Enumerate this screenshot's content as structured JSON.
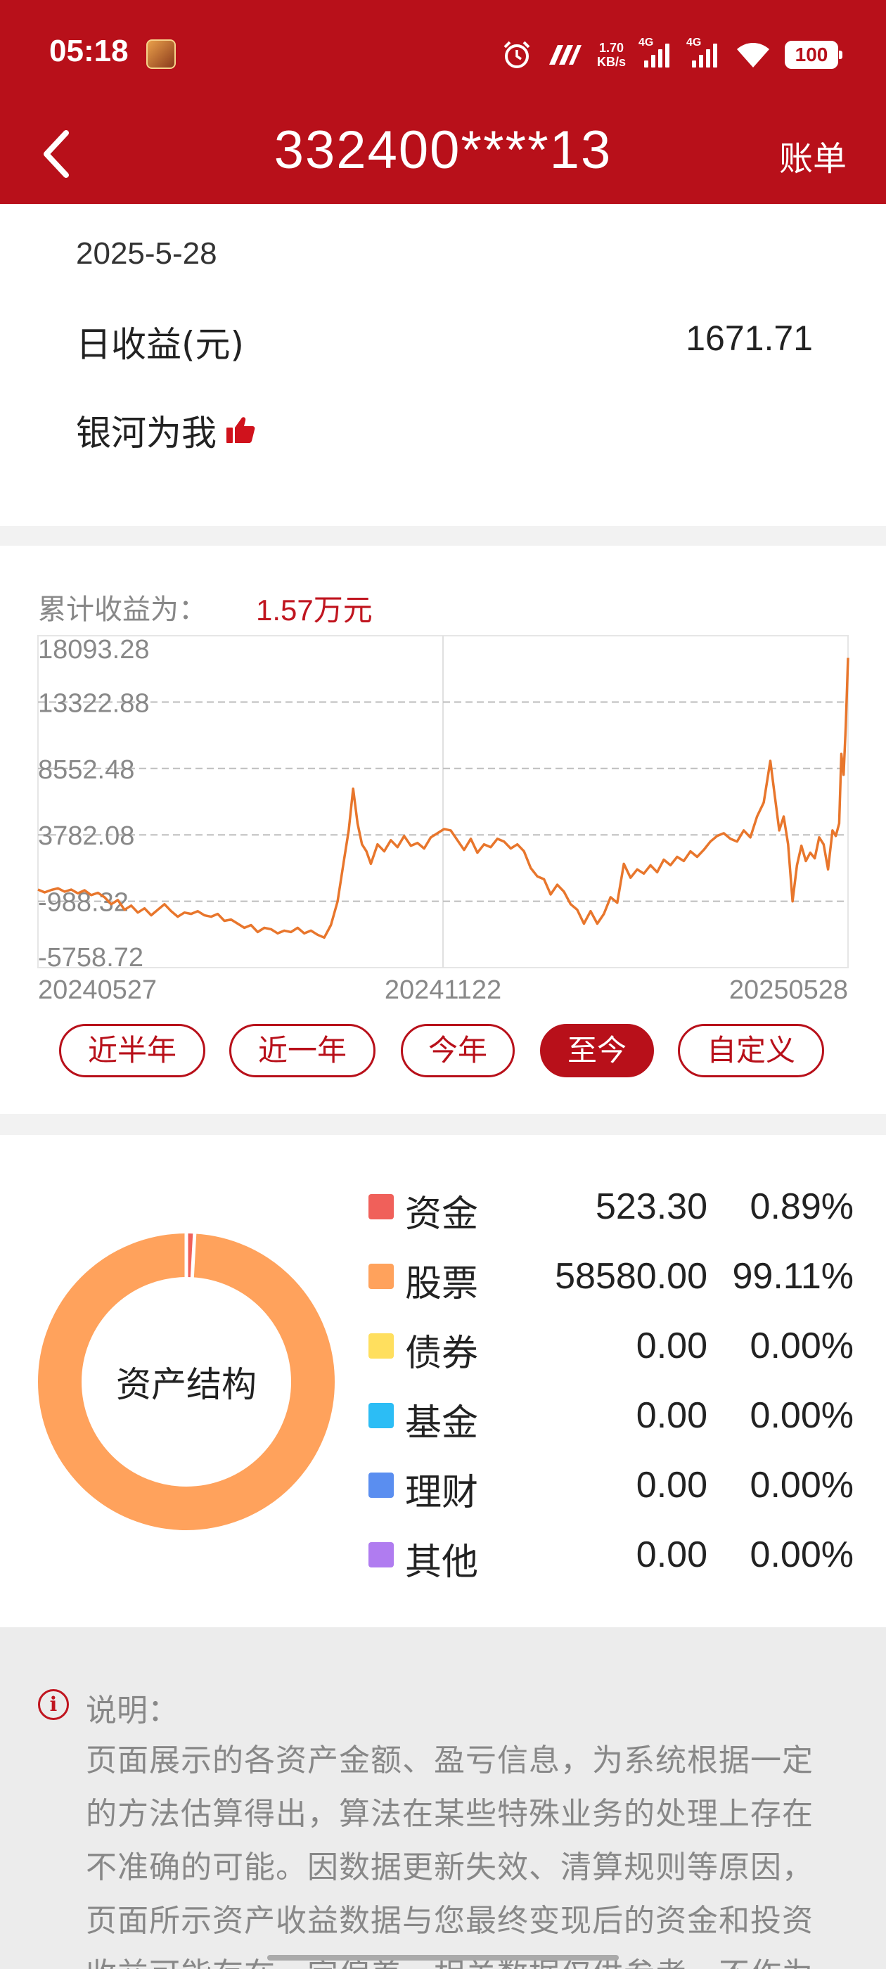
{
  "status_bar": {
    "time": "05:18",
    "net_speed_value": "1.70",
    "net_speed_unit": "KB/s",
    "signal1_label": "4G",
    "signal2_label": "4G",
    "battery": "100"
  },
  "header": {
    "title": "332400****13",
    "bill_label": "账单",
    "bg_color": "#b8101a"
  },
  "summary": {
    "date": "2025-5-28",
    "daily_label": "日收益(元)",
    "daily_value": "1671.71",
    "galaxy_label": "银河为我"
  },
  "cumulative": {
    "label": "累计收益为：",
    "value": "1.57万元"
  },
  "chart_data": {
    "type": "line",
    "y_ticks": [
      "18093.28",
      "13322.88",
      "8552.48",
      "3782.08",
      "-988.32",
      "-5758.72"
    ],
    "y_tick_values": [
      18093.28,
      13322.88,
      8552.48,
      3782.08,
      -988.32,
      -5758.72
    ],
    "ylim": [
      -5758.72,
      18093.28
    ],
    "x_ticks": [
      "20240527",
      "20241122",
      "20250528"
    ],
    "xlim": [
      0,
      365
    ],
    "grid": "dashed horizontal, vertical at midpoint",
    "line_color": "#e8762c",
    "points": [
      [
        0,
        -150
      ],
      [
        3,
        -350
      ],
      [
        6,
        -180
      ],
      [
        9,
        -60
      ],
      [
        12,
        -300
      ],
      [
        15,
        -150
      ],
      [
        18,
        -420
      ],
      [
        21,
        -200
      ],
      [
        24,
        -550
      ],
      [
        27,
        -380
      ],
      [
        30,
        -700
      ],
      [
        33,
        -1200
      ],
      [
        36,
        -900
      ],
      [
        39,
        -1600
      ],
      [
        42,
        -1300
      ],
      [
        45,
        -1800
      ],
      [
        48,
        -1500
      ],
      [
        51,
        -2000
      ],
      [
        54,
        -1600
      ],
      [
        57,
        -1200
      ],
      [
        60,
        -1700
      ],
      [
        63,
        -2100
      ],
      [
        66,
        -1800
      ],
      [
        69,
        -1900
      ],
      [
        72,
        -1700
      ],
      [
        75,
        -2000
      ],
      [
        78,
        -2100
      ],
      [
        81,
        -1900
      ],
      [
        84,
        -2400
      ],
      [
        87,
        -2300
      ],
      [
        90,
        -2600
      ],
      [
        93,
        -2900
      ],
      [
        96,
        -2700
      ],
      [
        99,
        -3200
      ],
      [
        102,
        -2900
      ],
      [
        105,
        -3000
      ],
      [
        108,
        -3300
      ],
      [
        111,
        -3100
      ],
      [
        114,
        -3200
      ],
      [
        117,
        -2900
      ],
      [
        120,
        -3300
      ],
      [
        123,
        -3100
      ],
      [
        126,
        -3400
      ],
      [
        129,
        -3600
      ],
      [
        132,
        -2700
      ],
      [
        135,
        -1000
      ],
      [
        138,
        2100
      ],
      [
        140,
        4100
      ],
      [
        142,
        7100
      ],
      [
        144,
        4600
      ],
      [
        146,
        3100
      ],
      [
        148,
        2600
      ],
      [
        150,
        1700
      ],
      [
        153,
        3100
      ],
      [
        156,
        2600
      ],
      [
        159,
        3400
      ],
      [
        162,
        2900
      ],
      [
        165,
        3700
      ],
      [
        168,
        3000
      ],
      [
        171,
        3200
      ],
      [
        174,
        2800
      ],
      [
        177,
        3600
      ],
      [
        180,
        3900
      ],
      [
        183,
        4200
      ],
      [
        186,
        4100
      ],
      [
        189,
        3400
      ],
      [
        192,
        2700
      ],
      [
        195,
        3500
      ],
      [
        198,
        2500
      ],
      [
        201,
        3100
      ],
      [
        204,
        2900
      ],
      [
        207,
        3500
      ],
      [
        210,
        3300
      ],
      [
        213,
        2800
      ],
      [
        216,
        3100
      ],
      [
        219,
        2600
      ],
      [
        222,
        1400
      ],
      [
        225,
        800
      ],
      [
        228,
        600
      ],
      [
        231,
        -500
      ],
      [
        234,
        200
      ],
      [
        237,
        -300
      ],
      [
        240,
        -1200
      ],
      [
        243,
        -1600
      ],
      [
        246,
        -2600
      ],
      [
        249,
        -1700
      ],
      [
        252,
        -2600
      ],
      [
        255,
        -1900
      ],
      [
        258,
        -700
      ],
      [
        261,
        -1100
      ],
      [
        264,
        1700
      ],
      [
        267,
        700
      ],
      [
        270,
        1300
      ],
      [
        273,
        1000
      ],
      [
        276,
        1600
      ],
      [
        279,
        1100
      ],
      [
        282,
        2000
      ],
      [
        285,
        1600
      ],
      [
        288,
        2200
      ],
      [
        291,
        1900
      ],
      [
        294,
        2600
      ],
      [
        297,
        2200
      ],
      [
        300,
        2700
      ],
      [
        303,
        3300
      ],
      [
        306,
        3700
      ],
      [
        309,
        3900
      ],
      [
        312,
        3500
      ],
      [
        315,
        3300
      ],
      [
        318,
        4100
      ],
      [
        321,
        3600
      ],
      [
        324,
        5100
      ],
      [
        327,
        6100
      ],
      [
        330,
        9100
      ],
      [
        332,
        6600
      ],
      [
        334,
        4100
      ],
      [
        336,
        5100
      ],
      [
        338,
        3100
      ],
      [
        340,
        -1000
      ],
      [
        342,
        1600
      ],
      [
        344,
        3000
      ],
      [
        346,
        1900
      ],
      [
        348,
        2500
      ],
      [
        350,
        2100
      ],
      [
        352,
        3600
      ],
      [
        354,
        3100
      ],
      [
        356,
        1300
      ],
      [
        358,
        4100
      ],
      [
        359.5,
        3700
      ],
      [
        361,
        4600
      ],
      [
        362,
        9600
      ],
      [
        363,
        8100
      ],
      [
        364,
        11600
      ],
      [
        365,
        16500
      ]
    ]
  },
  "range_buttons": [
    {
      "label": "近半年",
      "active": false
    },
    {
      "label": "近一年",
      "active": false
    },
    {
      "label": "今年",
      "active": false
    },
    {
      "label": "至今",
      "active": true
    },
    {
      "label": "自定义",
      "active": false
    }
  ],
  "asset_structure": {
    "center_label": "资产结构",
    "items": [
      {
        "name": "资金",
        "amount": "523.30",
        "percent": "0.89%",
        "pct_value": 0.89,
        "color": "#f0605a"
      },
      {
        "name": "股票",
        "amount": "58580.00",
        "percent": "99.11%",
        "pct_value": 99.11,
        "color": "#ffa25c"
      },
      {
        "name": "债券",
        "amount": "0.00",
        "percent": "0.00%",
        "pct_value": 0,
        "color": "#ffdf5e"
      },
      {
        "name": "基金",
        "amount": "0.00",
        "percent": "0.00%",
        "pct_value": 0,
        "color": "#2cbdf5"
      },
      {
        "name": "理财",
        "amount": "0.00",
        "percent": "0.00%",
        "pct_value": 0,
        "color": "#5a8ef0"
      },
      {
        "name": "其他",
        "amount": "0.00",
        "percent": "0.00%",
        "pct_value": 0,
        "color": "#b07cf0"
      }
    ]
  },
  "note": {
    "title": "说明：",
    "text": "页面展示的各资产金额、盈亏信息，为系统根据一定的方法估算得出，算法在某些特殊业务的处理上存在不准确的可能。因数据更新失效、清算规则等原因，页面所示资产收益数据与您最终变现后的资金和投资收益可能存在一定偏差。相关数据仅供参考，不作为"
  }
}
